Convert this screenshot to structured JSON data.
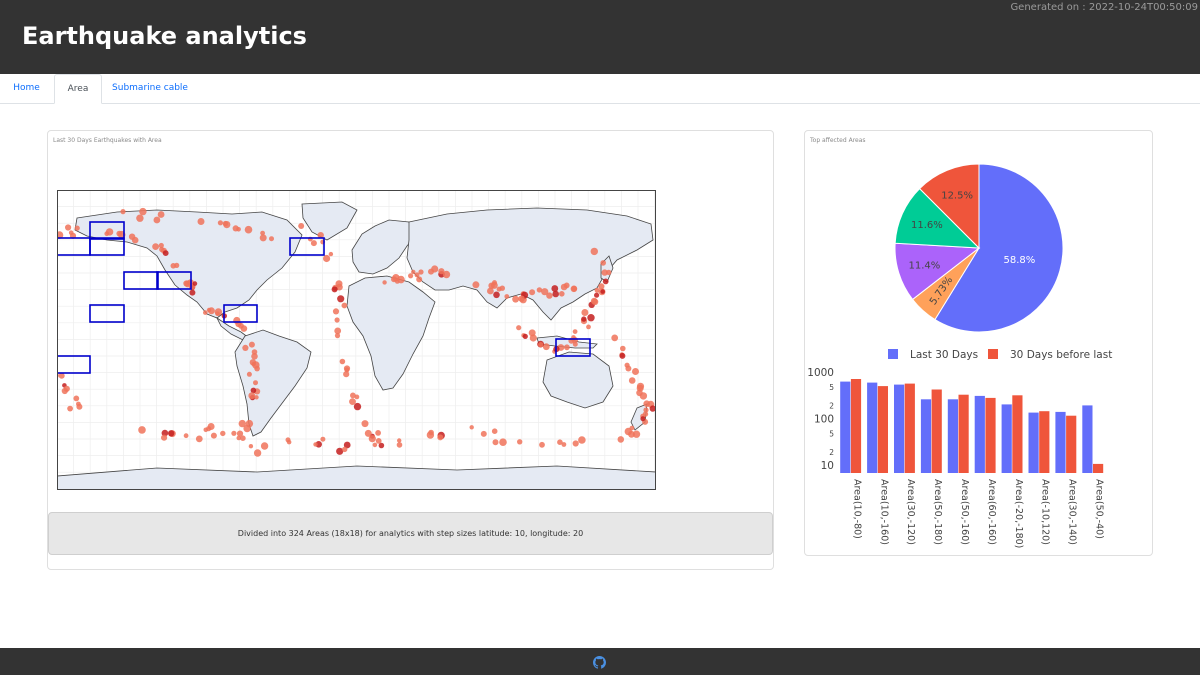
{
  "header": {
    "title": "Earthquake analytics",
    "generated": "Generated on : 2022-10-24T00:50:09"
  },
  "tabs": [
    {
      "label": "Home",
      "active": false
    },
    {
      "label": "Area",
      "active": true
    },
    {
      "label": "Submarine cable",
      "active": false
    }
  ],
  "map_card": {
    "title": "Last 30 Days Earthquakes with Area",
    "note": "Divided into 324 Areas (18x18) for analytics with step sizes latitude: 10, longitude: 20",
    "highlighted_areas": [
      "Area(10,-80)",
      "Area(10,-160)",
      "Area(30,-120)",
      "Area(50,-180)",
      "Area(50,-160)",
      "Area(60,-160)",
      "Area(-20,-180)",
      "Area(-10,120)",
      "Area(30,-140)",
      "Area(50,-40)"
    ],
    "land_color": "#e5eaf3",
    "quake_color": "#f0735a",
    "box_color": "#0000cc"
  },
  "right_card": {
    "title": "Top affected Areas"
  },
  "chart_data": [
    {
      "type": "pie",
      "labels": [
        "58.8%",
        "5.73%",
        "11.4%",
        "11.6%",
        "12.5%"
      ],
      "values": [
        58.8,
        5.73,
        11.4,
        11.6,
        12.5
      ],
      "colors": [
        "#636efa",
        "#ffa15a",
        "#ab63fa",
        "#00cc96",
        "#ef553b"
      ]
    },
    {
      "type": "bar",
      "categories": [
        "Area(10,-80)",
        "Area(10,-160)",
        "Area(30,-120)",
        "Area(50,-180)",
        "Area(50,-160)",
        "Area(60,-160)",
        "Area(-20,-180)",
        "Area(-10,120)",
        "Area(30,-140)",
        "Area(50,-40)"
      ],
      "series": [
        {
          "name": "Last 30 Days",
          "color": "#636efa",
          "values": [
            650,
            620,
            560,
            270,
            270,
            320,
            210,
            140,
            145,
            200
          ]
        },
        {
          "name": "30 Days before last",
          "color": "#ef553b",
          "values": [
            740,
            520,
            590,
            440,
            340,
            290,
            330,
            150,
            120,
            11
          ]
        }
      ],
      "yscale": "log",
      "ylim": [
        7,
        1100
      ],
      "ytick_labels": [
        "10",
        "2",
        "5",
        "100",
        "2",
        "5",
        "1000"
      ],
      "ytick_values": [
        10,
        20,
        50,
        100,
        200,
        500,
        1000
      ],
      "legend": "top"
    }
  ]
}
